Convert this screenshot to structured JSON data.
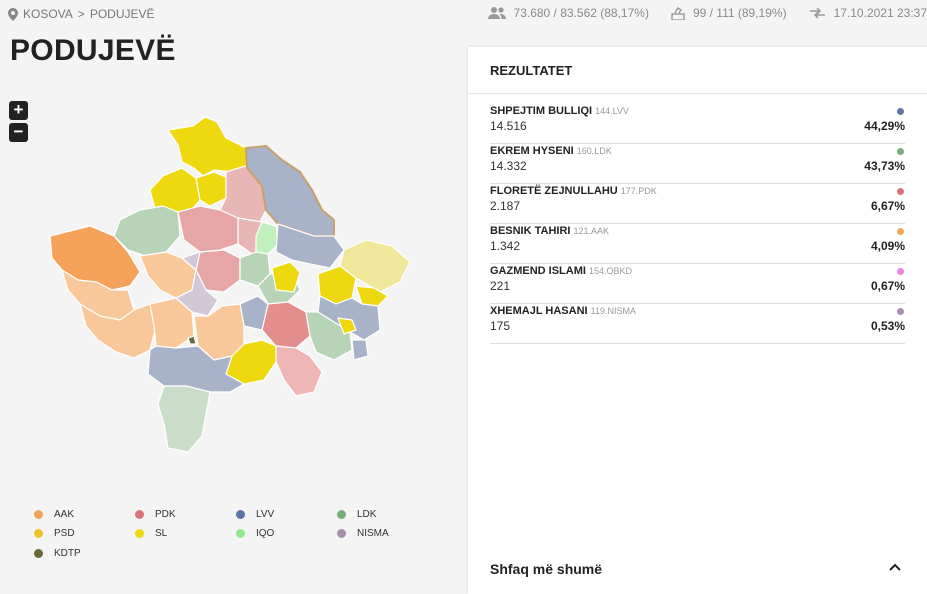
{
  "breadcrumb": {
    "root": "KOSOVA",
    "sep": ">",
    "current": "PODUJEVË"
  },
  "stats": {
    "voters": "73.680 / 83.562 (88,17%)",
    "stations": "99 / 111 (89,19%)",
    "updated": "17.10.2021 23:37"
  },
  "page_title": "PODUJEVË",
  "zoom": {
    "in": "+",
    "out": "−"
  },
  "legend": [
    {
      "label": "AAK",
      "color": "#f5a35a"
    },
    {
      "label": "PDK",
      "color": "#d9757a"
    },
    {
      "label": "LVV",
      "color": "#5c74a6"
    },
    {
      "label": "LDK",
      "color": "#79ad7a"
    },
    {
      "label": "PSD",
      "color": "#ebc228"
    },
    {
      "label": "SL",
      "color": "#eed80f"
    },
    {
      "label": "IQO",
      "color": "#8fe88f"
    },
    {
      "label": "NISMA",
      "color": "#a591ad"
    },
    {
      "label": "KDTP",
      "color": "#6b6a34"
    }
  ],
  "results": {
    "title": "REZULTATET",
    "candidates": [
      {
        "name": "SHPEJTIM BULLIQI",
        "code": "144.LVV",
        "votes": "14.516",
        "pct": "44,29%",
        "color": "#5c74a6"
      },
      {
        "name": "EKREM HYSENI",
        "code": "160.LDK",
        "votes": "14.332",
        "pct": "43,73%",
        "color": "#79ad7a"
      },
      {
        "name": "FLORETË ZEJNULLAHU",
        "code": "177.PDK",
        "votes": "2.187",
        "pct": "6,67%",
        "color": "#d9757a"
      },
      {
        "name": "BESNIK TAHIRI",
        "code": "121.AAK",
        "votes": "1.342",
        "pct": "4,09%",
        "color": "#f5a35a"
      },
      {
        "name": "GAZMEND ISLAMI",
        "code": "154.OBKD",
        "votes": "221",
        "pct": "0,67%",
        "color": "#e488e0"
      },
      {
        "name": "XHEMAJL HASANI",
        "code": "119.NISMA",
        "votes": "175",
        "pct": "0,53%",
        "color": "#a591ad"
      }
    ],
    "show_more": "Shfaq më shumë"
  }
}
